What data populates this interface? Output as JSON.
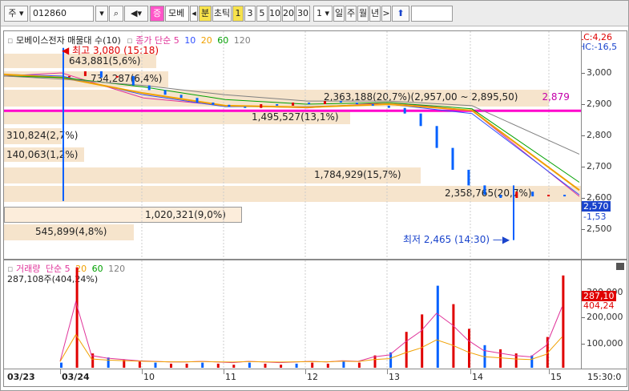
{
  "toolbar": {
    "market": "주",
    "code": "012860",
    "name": "모베",
    "period_unit": "분",
    "tick": "초틱",
    "intervals": [
      "1",
      "3",
      "5",
      "10",
      "20",
      "30"
    ],
    "n_value": "1",
    "day": "일",
    "week": "주",
    "month": "월",
    "year": "년",
    "arrow": ">",
    "up_arrow": "⬆"
  },
  "price_legend": {
    "title": "모베이스전자 매물대 수(10)",
    "close": "종가 단순",
    "ma5": "5",
    "ma10": "10",
    "ma20": "20",
    "ma60": "60",
    "ma120": "120"
  },
  "volume_legend": {
    "title": "거래량",
    "simple": "단순",
    "ma5": "5",
    "ma20": "20",
    "ma60": "60",
    "ma120": "120",
    "current": "287,108주(404,24%)"
  },
  "annotations": {
    "high": "최고 3,080 (15:18)",
    "low": "최저 2,465 (14:30)",
    "range": "2,363,188(20,7%)(2,957,00 ~ 2,895,50)",
    "range_right": "2,879",
    "lc": "LC:4,26",
    "hc": "HC:-16,5"
  },
  "bands": [
    {
      "label": "643,881(5,6%)"
    },
    {
      "label": "734,287(6,4%)"
    },
    {
      "label": "1,495,527(13,1%)"
    },
    {
      "label": "310,824(2,7%)"
    },
    {
      "label": "140,063(1,2%)"
    },
    {
      "label": "1,784,929(15,7%)"
    },
    {
      "label": "2,358,765(20,7%)"
    },
    {
      "label": "1,020,321(9,0%)"
    },
    {
      "label": "545,899(4,8%)"
    }
  ],
  "price_axis": [
    "3,000",
    "2,900",
    "2,800",
    "2,700",
    "2,600",
    "2,500"
  ],
  "current_price": "2,570",
  "current_change": "-1,53",
  "volume_axis": [
    "300,000",
    "200,000",
    "100,000"
  ],
  "volume_current": "287,10",
  "volume_pct": "404,24",
  "x_axis": [
    "03/23",
    "03/24",
    "10",
    "11",
    "12",
    "13",
    "14",
    "15",
    "15:30:0"
  ],
  "colors": {
    "ma5": "#e0349a",
    "ma10": "#3050ff",
    "ma20": "#f0a000",
    "ma60": "#00a000",
    "ma120": "#808080",
    "line_marker": "#ff00cc",
    "up": "#e00000",
    "down": "#0060ff"
  },
  "chart_data": {
    "type": "line",
    "title": "",
    "xlabel": "",
    "ylabel": "",
    "ylim": [
      2450,
      3080
    ],
    "horizontal_line": 2879,
    "high": {
      "value": 3080,
      "time": "15:18"
    },
    "low": {
      "value": 2465,
      "time": "14:30"
    },
    "x": [
      "03/23",
      "03/24",
      "10",
      "11",
      "12",
      "13",
      "14",
      "15"
    ],
    "series": [
      {
        "name": "5",
        "values": [
          2990,
          3000,
          2920,
          2895,
          2888,
          2905,
          2880,
          2605
        ]
      },
      {
        "name": "10",
        "values": [
          2995,
          2990,
          2930,
          2892,
          2892,
          2900,
          2870,
          2610
        ]
      },
      {
        "name": "20",
        "values": [
          2995,
          2985,
          2935,
          2895,
          2890,
          2900,
          2880,
          2625
        ]
      },
      {
        "name": "60",
        "values": [
          2990,
          2985,
          2955,
          2915,
          2900,
          2905,
          2885,
          2650
        ]
      },
      {
        "name": "120",
        "values": [
          2990,
          2980,
          2960,
          2930,
          2910,
          2910,
          2895,
          2740
        ]
      }
    ],
    "price_bars": [
      {
        "label": "643,881(5,6%)",
        "volume": 643881,
        "pct": 5.6,
        "level": 3035
      },
      {
        "label": "734,287(6,4%)",
        "volume": 734287,
        "pct": 6.4,
        "level": 2975
      },
      {
        "label": "2,363,188(20,7%)",
        "volume": 2363188,
        "pct": 20.7,
        "level": 2915
      },
      {
        "label": "1,495,527(13,1%)",
        "volume": 1495527,
        "pct": 13.1,
        "level": 2870
      },
      {
        "label": "310,824(2,7%)",
        "volume": 310824,
        "pct": 2.7,
        "level": 2820
      },
      {
        "label": "140,063(1,2%)",
        "volume": 140063,
        "pct": 1.2,
        "level": 2765
      },
      {
        "label": "1,784,929(15,7%)",
        "volume": 1784929,
        "pct": 15.7,
        "level": 2710
      },
      {
        "label": "2,358,765(20,7%)",
        "volume": 2358765,
        "pct": 20.7,
        "level": 2655
      },
      {
        "label": "1,020,321(9,0%)",
        "volume": 1020321,
        "pct": 9.0,
        "level": 2600
      },
      {
        "label": "545,899(4,8%)",
        "volume": 545899,
        "pct": 4.8,
        "level": 2545
      }
    ],
    "volume": {
      "ylim": [
        0,
        320000
      ],
      "current": 287108,
      "current_pct": 404.24
    }
  }
}
